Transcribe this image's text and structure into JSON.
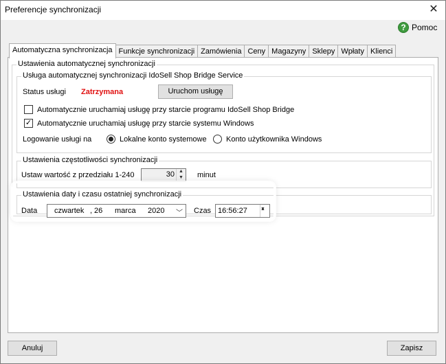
{
  "window": {
    "title": "Preferencje synchronizacji",
    "close": "✕"
  },
  "help": {
    "label": "Pomoc",
    "icon": "?"
  },
  "tabs": [
    {
      "label": "Automatyczna synchronizacja",
      "active": true
    },
    {
      "label": "Funkcje synchronizacji"
    },
    {
      "label": "Zamówienia"
    },
    {
      "label": "Ceny"
    },
    {
      "label": "Magazyny"
    },
    {
      "label": "Sklepy"
    },
    {
      "label": "Wpłaty"
    },
    {
      "label": "Klienci"
    }
  ],
  "auto_sync": {
    "group_label": "Ustawienia automatycznej synchronizacji",
    "service": {
      "group_label": "Usługa automatycznej synchronizacji IdoSell Shop Bridge Service",
      "status_label": "Status usługi",
      "status_value": "Zatrzymana",
      "start_button": "Uruchom usługę",
      "chk1_label": "Automatycznie uruchamiaj usługę przy starcie programu IdoSell Shop Bridge",
      "chk1_checked": false,
      "chk2_label": "Automatycznie uruchamiaj usługę przy starcie systemu Windows",
      "chk2_checked": true,
      "login_label": "Logowanie usługi na",
      "radio1_label": "Lokalne konto systemowe",
      "radio2_label": "Konto użytkownika Windows"
    },
    "frequency": {
      "group_label": "Ustawienia częstotliwości synchronizacji",
      "range_label": "Ustaw wartość z przedziału 1-240",
      "value": "30",
      "unit": "minut"
    },
    "last_sync": {
      "group_label": "Ustawienia daty i czasu ostatniej synchronizacji",
      "date_label": "Data",
      "date_weekday": "czwartek",
      "date_sep": ",",
      "date_day": "26",
      "date_month": "marca",
      "date_year": "2020",
      "time_label": "Czas",
      "time_value": "16:56:27"
    }
  },
  "footer": {
    "cancel": "Anuluj",
    "save": "Zapisz"
  }
}
